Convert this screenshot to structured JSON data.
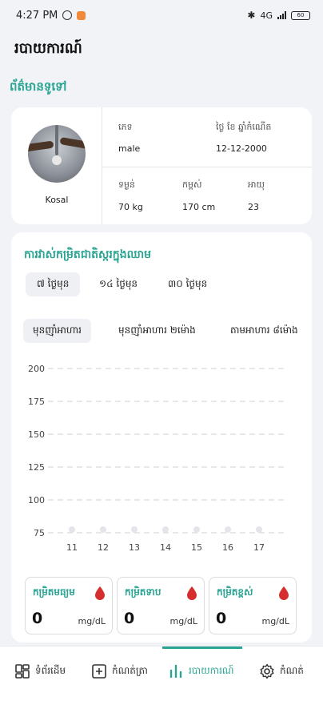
{
  "status": {
    "time": "4:27 PM",
    "network": "4G",
    "battery": "60"
  },
  "page_title": "របាយការណ៍",
  "general_info": {
    "section_title": "ព័ត៌មានទូទៅ",
    "name": "Kosal",
    "sex_label": "ភេទ",
    "sex_value": "male",
    "dob_label": "ថ្ងៃ ខែ ឆ្នាំកំណើត",
    "dob_value": "12-12-2000",
    "weight_label": "ទម្ងន់",
    "weight_value": "70 kg",
    "height_label": "កម្ពស់",
    "height_value": "170 cm",
    "age_label": "អាយុ",
    "age_value": "23"
  },
  "glucose": {
    "title": "ការវាស់កម្រិតជាតិស្ករក្នុងឈាម",
    "period_tabs": [
      "៧ ថ្ងៃមុន",
      "១៤ ថ្ងៃមុន",
      "៣០ ថ្ងៃមុន"
    ],
    "meal_tabs": [
      "មុនញ៉ាំអាហារ",
      "មុនញ៉ាំអាហារ ២ម៉ោង",
      "តាមអាហារ ៨ម៉ោង"
    ],
    "stats": [
      {
        "label": "កម្រិតមធ្យម",
        "value": "0",
        "unit": "mg/dL"
      },
      {
        "label": "កម្រិតទាប",
        "value": "0",
        "unit": "mg/dL"
      },
      {
        "label": "កម្រិតខ្ពស់",
        "value": "0",
        "unit": "mg/dL"
      }
    ]
  },
  "chart_data": {
    "type": "line",
    "x": [
      11,
      12,
      13,
      14,
      15,
      16,
      17
    ],
    "y_ticks": [
      75,
      100,
      125,
      150,
      175,
      200
    ],
    "ylim": [
      75,
      200
    ],
    "series": [
      {
        "values": [
          75,
          75,
          75,
          75,
          75,
          75,
          75
        ]
      }
    ],
    "grid": "dashed-horizontal",
    "colors": {
      "grid": "#d0d2d8",
      "point": "#e4e5ea"
    }
  },
  "bottom_nav": {
    "items": [
      "ទំព័រដើម",
      "កំណត់ត្រា",
      "របាយការណ៍",
      "កំណត់"
    ],
    "active": "របាយការណ៍"
  },
  "colors": {
    "accent": "#2aa493",
    "drop": "#d62d2d"
  }
}
